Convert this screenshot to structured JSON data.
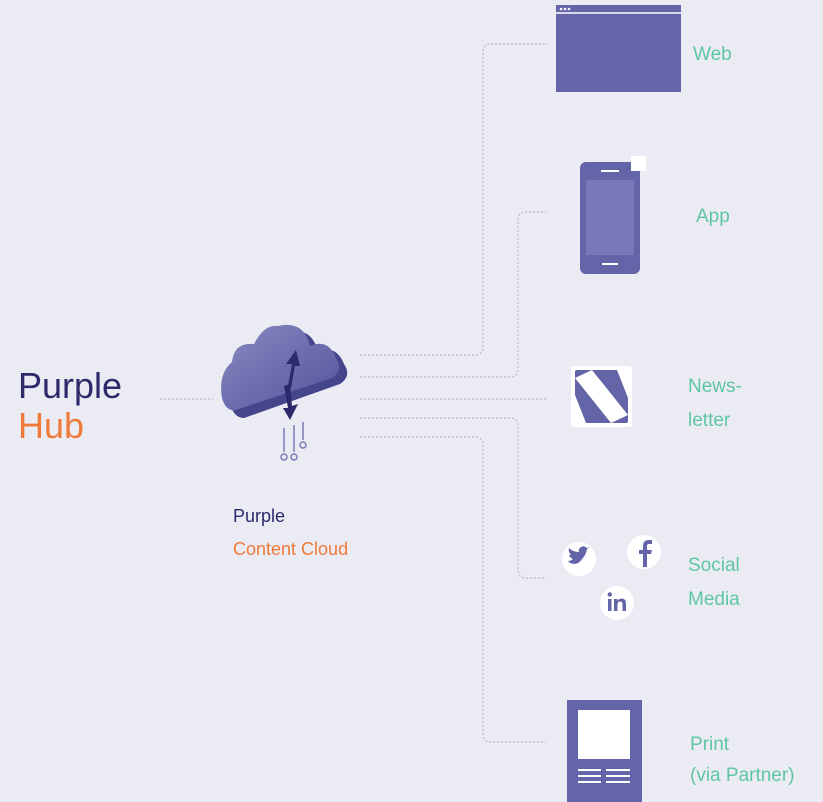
{
  "hub": {
    "line1": "Purple",
    "line2": "Hub"
  },
  "cloud": {
    "line1": "Purple",
    "line2": "Content Cloud"
  },
  "channels": [
    {
      "id": "web",
      "icon": "browser-window-icon",
      "lines": [
        "Web"
      ]
    },
    {
      "id": "app",
      "icon": "smartphone-icon",
      "lines": [
        "App"
      ]
    },
    {
      "id": "newsletter",
      "icon": "newsletter-icon",
      "lines": [
        "News-",
        "letter"
      ]
    },
    {
      "id": "social-media",
      "icon": "social-media-icons",
      "lines": [
        "Social",
        "Media"
      ],
      "sub_icons": [
        "twitter-icon",
        "facebook-icon",
        "linkedin-icon"
      ]
    },
    {
      "id": "print",
      "icon": "print-document-icon",
      "lines": [
        "Print",
        "(via Partner)"
      ]
    }
  ],
  "colors": {
    "background": "#ebebf4",
    "icon_primary": "#6464a8",
    "hub_dark": "#2d2a6b",
    "accent_orange": "#ef7a3a",
    "label_green": "#5ec7a2",
    "connector": "#b4b4cc"
  }
}
